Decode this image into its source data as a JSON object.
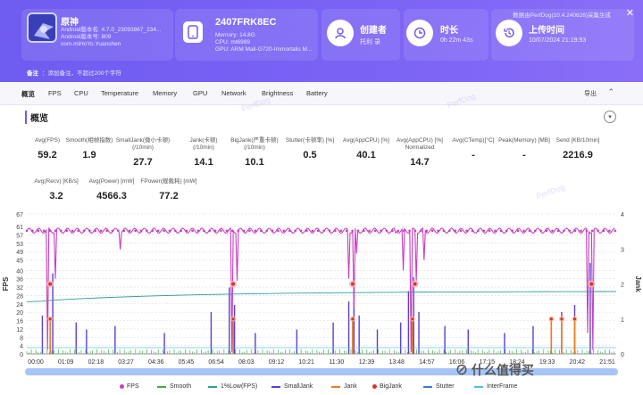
{
  "app": {
    "name": "原神",
    "version": "Android版本名: 4.7.0_23093867_234...",
    "build": "Android版本号: 809",
    "package": "com.miHoYo.Yuanshen"
  },
  "device": {
    "name": "2407FRK8EC",
    "memory": "Memory: 14.8G",
    "cpu": "CPU: mt6989",
    "gpu": "GPU: ARM Mali-G720-Immortalis M..."
  },
  "creator": {
    "title": "创建者",
    "value": "托利 录"
  },
  "duration": {
    "title": "时长",
    "value": "0h 22m 43s"
  },
  "upload": {
    "title": "上传时间",
    "value": "10/07/2024 21:19:53"
  },
  "data_source": "数据由PerfDog(10.4.240628)采集生成",
  "remark": {
    "label": "备注",
    "placeholder": "添加备注，不超过200个字符"
  },
  "tabs": [
    "概览",
    "FPS",
    "CPU",
    "Temperature",
    "Memory",
    "GPU",
    "Network",
    "Brightness",
    "Battery"
  ],
  "export_label": "导出",
  "section_title": "概览",
  "metrics_row1": [
    {
      "label": "Avg(FPS)",
      "value": "59.2"
    },
    {
      "label": "Smooth(相帧指数)",
      "value": "1.9"
    },
    {
      "label": "SmallJank(微小卡顿)\n(/10min)",
      "value": "27.7"
    },
    {
      "label": "Jank(卡顿)\n(/10min)",
      "value": "14.1"
    },
    {
      "label": "BigJank(严重卡顿)\n(/10min)",
      "value": "10.1"
    },
    {
      "label": "Stutter(卡顿率) [%]",
      "value": "0.5"
    },
    {
      "label": "Avg(AppCPU) [%]",
      "value": "40.1"
    },
    {
      "label": "Avg(AppCPU) [%]\nNormalized",
      "value": "14.7"
    },
    {
      "label": "Avg(CTemp)[°C]",
      "value": "-"
    },
    {
      "label": "Peak(Memory) [MB]",
      "value": "-"
    },
    {
      "label": "Send [KB/10min]",
      "value": "2216.9"
    }
  ],
  "metrics_row2": [
    {
      "label": "Avg(Recv) [KB/s]",
      "value": "3.2"
    },
    {
      "label": "Avg(Power) [mW]",
      "value": "4566.3"
    },
    {
      "label": "FPower(舰载耗) [mW]",
      "value": "77.2"
    }
  ],
  "chart_data": {
    "type": "line",
    "ylabel": "FPS",
    "y2label": "Jank",
    "y_ticks": [
      0,
      4,
      8,
      12,
      16,
      20,
      24,
      28,
      32,
      36,
      40,
      45,
      49,
      53,
      57,
      61,
      67
    ],
    "y2_ticks": [
      0,
      1,
      2,
      3,
      4
    ],
    "x_ticks": [
      "00:00",
      "01:09",
      "02:18",
      "03:27",
      "04:36",
      "05:45",
      "06:54",
      "08:03",
      "09:12",
      "10:21",
      "11:30",
      "12:39",
      "13:48",
      "14:57",
      "16:06",
      "17:15",
      "18:24",
      "19:33",
      "20:42",
      "21:51"
    ],
    "ylim": [
      0,
      67
    ],
    "y2lim": [
      0,
      4
    ],
    "series": [
      {
        "name": "FPS",
        "color": "#c83fc0"
      },
      {
        "name": "Smooth",
        "color": "#3fae48"
      },
      {
        "name": "1%Low(FPS)",
        "color": "#2e9e9a"
      },
      {
        "name": "SmallJank",
        "color": "#5b3fd6"
      },
      {
        "name": "Jank",
        "color": "#f07a1a"
      },
      {
        "name": "BigJank",
        "color": "#d9342b"
      },
      {
        "name": "Stutter",
        "color": "#3a78d6"
      },
      {
        "name": "InterFrame",
        "color": "#48c4e0"
      }
    ],
    "fps_baseline": 59,
    "fps_dips": [
      [
        0.8,
        2
      ],
      [
        1.1,
        36
      ],
      [
        3.6,
        50
      ],
      [
        7.9,
        1
      ],
      [
        8.1,
        35
      ],
      [
        12.4,
        36
      ],
      [
        12.6,
        22
      ],
      [
        12.7,
        48
      ],
      [
        14.2,
        58
      ],
      [
        14.5,
        40
      ],
      [
        14.8,
        1
      ],
      [
        15.0,
        35
      ],
      [
        15.3,
        45
      ],
      [
        21.6,
        10
      ],
      [
        21.8,
        2
      ]
    ],
    "low1_start": 25,
    "low1_end": 30,
    "jank_markers_hi": [
      0.9,
      7.95,
      12.55,
      14.95,
      21.75
    ],
    "jank_markers_lo": [
      0.9,
      7.95,
      12.55,
      14.85,
      20.2,
      20.6,
      21.1
    ],
    "smalljank_spikes": [
      [
        0.6,
        1.1
      ],
      [
        1.0,
        2.3
      ],
      [
        1.9,
        0.9
      ],
      [
        2.3,
        0.7
      ],
      [
        3.4,
        0.8
      ],
      [
        5.3,
        0.6
      ],
      [
        7.1,
        1.2
      ],
      [
        7.8,
        1.9
      ],
      [
        8.0,
        1.4
      ],
      [
        8.8,
        0.6
      ],
      [
        10.4,
        0.7
      ],
      [
        11.8,
        0.9
      ],
      [
        12.4,
        1.5
      ],
      [
        12.6,
        2.1
      ],
      [
        12.8,
        1.1
      ],
      [
        13.5,
        0.7
      ],
      [
        14.4,
        0.9
      ],
      [
        14.7,
        1.8
      ],
      [
        14.9,
        2.2
      ],
      [
        15.1,
        1.2
      ],
      [
        16.1,
        0.8
      ],
      [
        17.0,
        0.7
      ],
      [
        18.4,
        0.6
      ],
      [
        19.5,
        0.8
      ],
      [
        20.2,
        1.0
      ],
      [
        20.6,
        1.2
      ],
      [
        21.1,
        1.4
      ],
      [
        21.7,
        2.6
      ]
    ]
  },
  "brand": "⊘ 什么值得买",
  "watermark": "PerfDog"
}
